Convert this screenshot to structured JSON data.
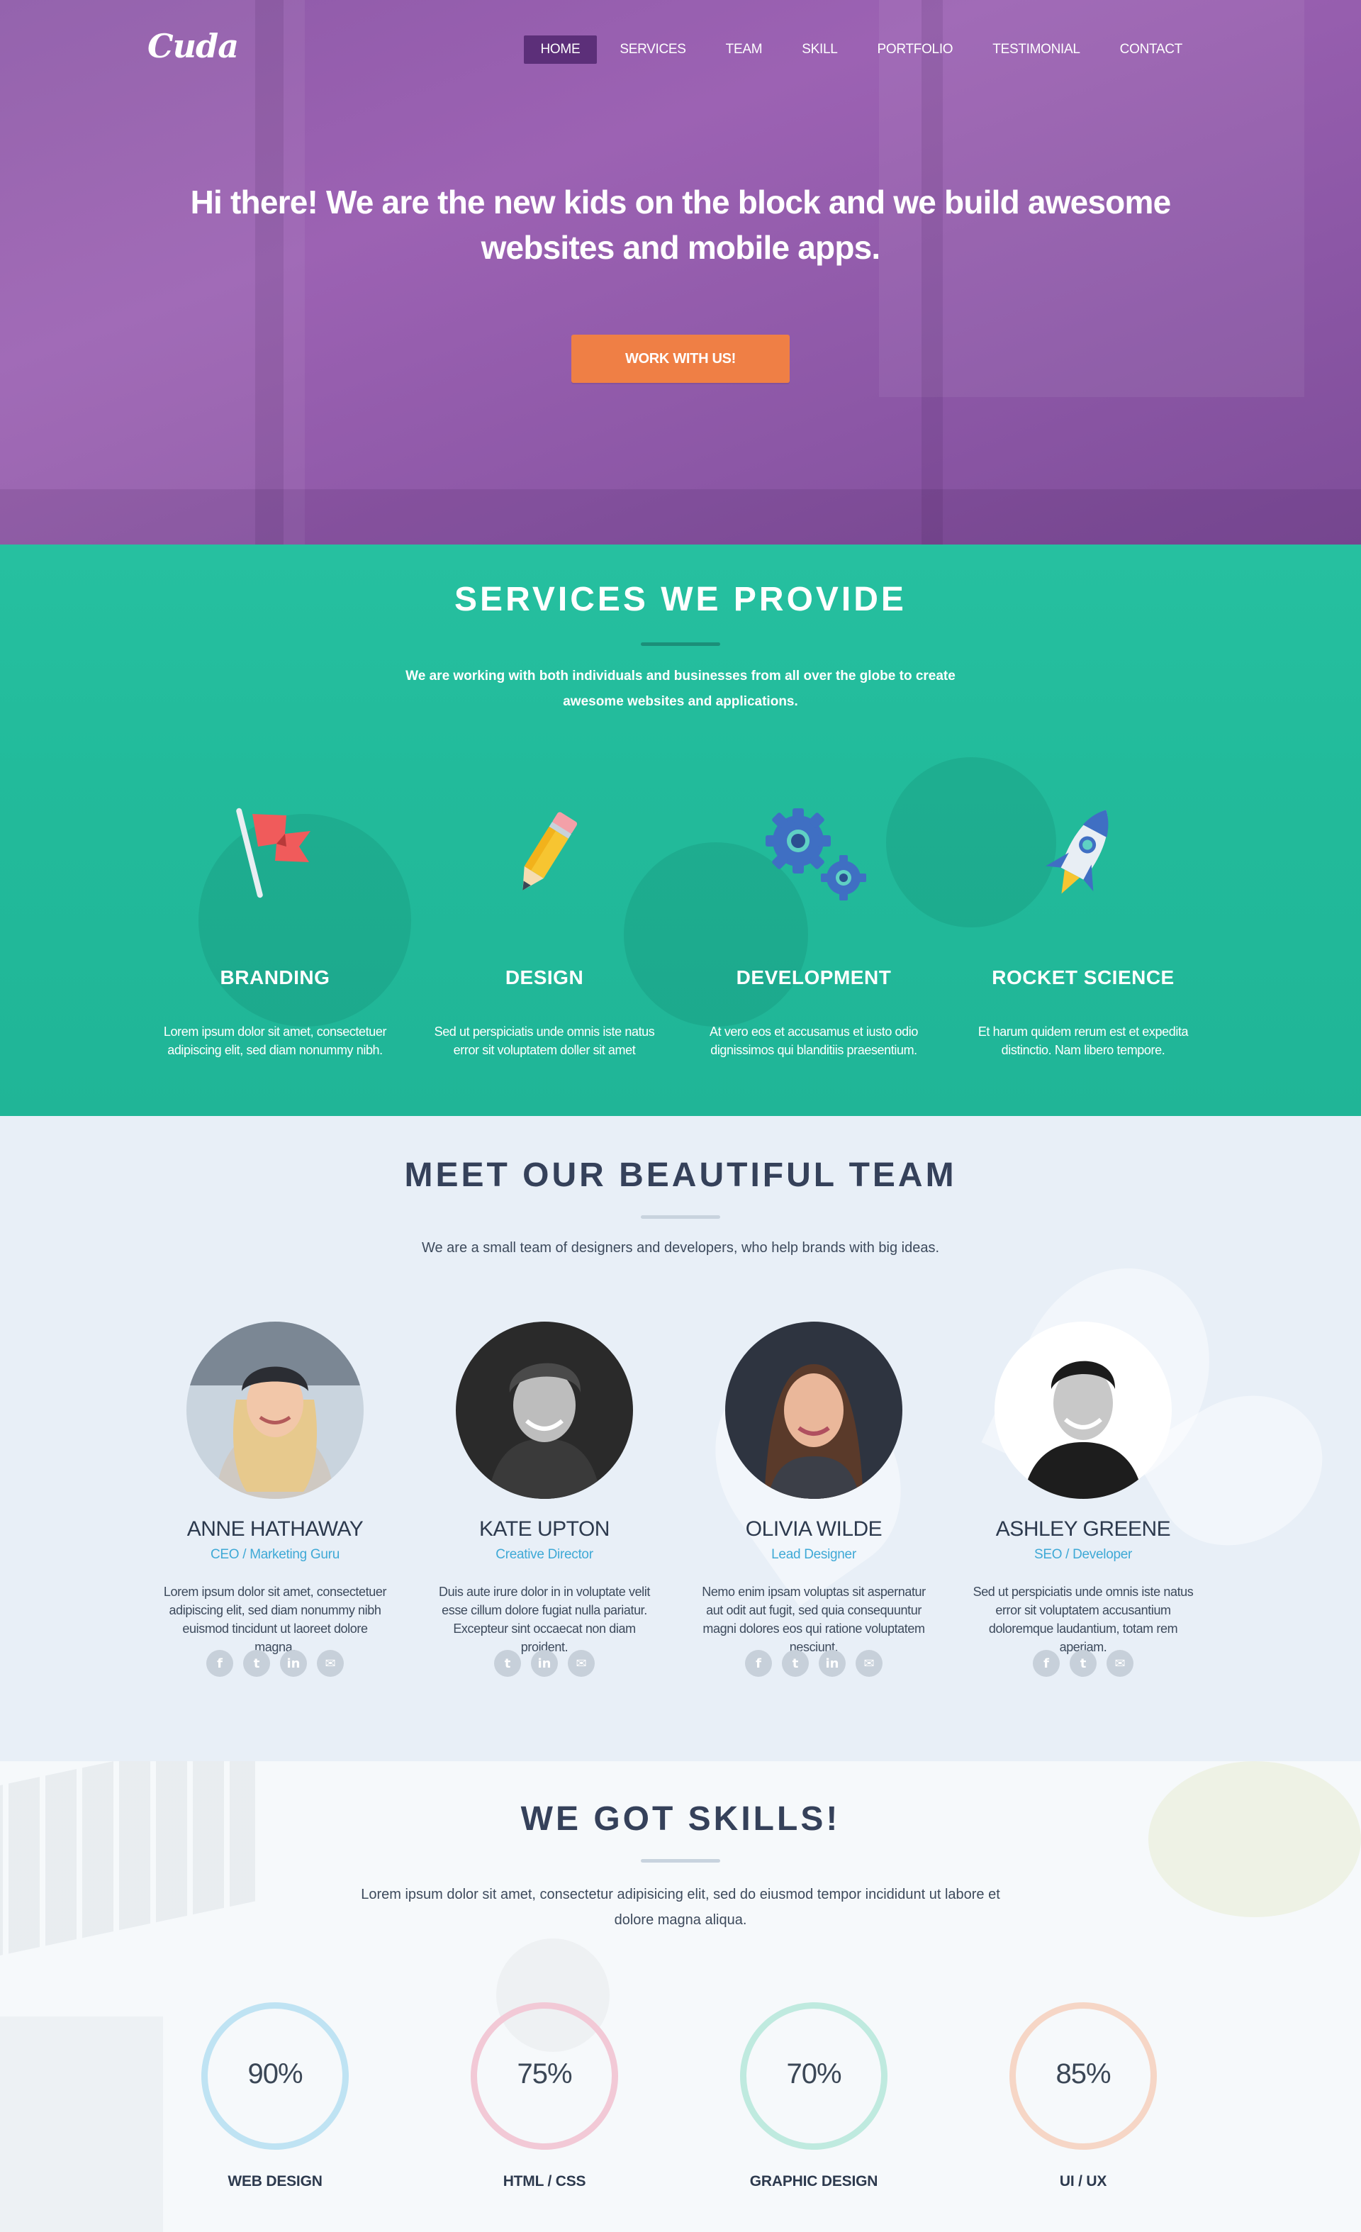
{
  "brand": {
    "logo": "Cuda"
  },
  "nav": {
    "items": [
      {
        "label": "HOME",
        "active": true
      },
      {
        "label": "SERVICES",
        "active": false
      },
      {
        "label": "TEAM",
        "active": false
      },
      {
        "label": "SKILL",
        "active": false
      },
      {
        "label": "PORTFOLIO",
        "active": false
      },
      {
        "label": "TESTIMONIAL",
        "active": false
      },
      {
        "label": "CONTACT",
        "active": false
      }
    ]
  },
  "hero": {
    "title": "Hi there! We are the new kids on the block and we build awesome websites and mobile apps.",
    "cta": "WORK WITH US!"
  },
  "services": {
    "title": "SERVICES WE PROVIDE",
    "subtitle": "We are working with both individuals and businesses from all over the globe to create awesome websites and applications.",
    "items": [
      {
        "title": "BRANDING",
        "icon": "flag-icon",
        "text": "Lorem ipsum dolor sit amet, consectetuer adipiscing elit, sed diam nonummy nibh."
      },
      {
        "title": "DESIGN",
        "icon": "pencil-icon",
        "text": "Sed ut perspiciatis unde omnis iste natus error sit voluptatem doller sit amet"
      },
      {
        "title": "DEVELOPMENT",
        "icon": "gears-icon",
        "text": "At vero eos et accusamus et iusto odio dignissimos qui blanditiis praesentium."
      },
      {
        "title": "ROCKET SCIENCE",
        "icon": "rocket-icon",
        "text": "Et harum quidem rerum est et expedita distinctio. Nam libero tempore."
      }
    ]
  },
  "team": {
    "title": "MEET OUR BEAUTIFUL TEAM",
    "subtitle": "We are a small team of designers and developers, who help brands with big ideas.",
    "members": [
      {
        "name": "ANNE HATHAWAY",
        "role": "CEO / Marketing Guru",
        "bio": "Lorem ipsum dolor sit amet, consectetuer adipiscing elit, sed diam nonummy nibh euismod tincidunt ut laoreet dolore magna.",
        "socials": [
          "facebook-icon",
          "twitter-icon",
          "linkedin-icon",
          "email-icon"
        ]
      },
      {
        "name": "KATE UPTON",
        "role": "Creative Director",
        "bio": "Duis aute irure dolor in in voluptate velit esse cillum dolore fugiat nulla pariatur. Excepteur sint occaecat non diam proident.",
        "socials": [
          "twitter-icon",
          "linkedin-icon",
          "email-icon"
        ]
      },
      {
        "name": "OLIVIA WILDE",
        "role": "Lead Designer",
        "bio": "Nemo enim ipsam voluptas sit aspernatur aut odit aut fugit, sed quia consequuntur magni dolores eos qui ratione voluptatem nesciunt.",
        "socials": [
          "facebook-icon",
          "twitter-icon",
          "linkedin-icon",
          "email-icon"
        ]
      },
      {
        "name": "ASHLEY GREENE",
        "role": "SEO / Developer",
        "bio": "Sed ut perspiciatis unde omnis iste natus error sit voluptatem accusantium doloremque laudantium, totam rem aperiam.",
        "socials": [
          "facebook-icon",
          "twitter-icon",
          "email-icon"
        ]
      }
    ]
  },
  "skills": {
    "title": "WE GOT SKILLS!",
    "subtitle": "Lorem ipsum dolor sit amet, consectetur adipisicing elit, sed do eiusmod tempor incididunt ut labore et dolore magna aliqua.",
    "items": [
      {
        "label": "WEB DESIGN",
        "percent": "90%",
        "color": "#bfe3f3"
      },
      {
        "label": "HTML / CSS",
        "percent": "75%",
        "color": "#f2c9d6"
      },
      {
        "label": "GRAPHIC DESIGN",
        "percent": "70%",
        "color": "#bfeadf"
      },
      {
        "label": "UI / UX",
        "percent": "85%",
        "color": "#f6d6c6"
      }
    ]
  },
  "colors": {
    "hero": "#9560ae",
    "active_nav": "#5c2f79",
    "cta": "#ef7f45",
    "services": "#23bd9d",
    "team_bg": "#e8eff7",
    "role": "#3fa9d6",
    "heading": "#2d3a4e"
  }
}
